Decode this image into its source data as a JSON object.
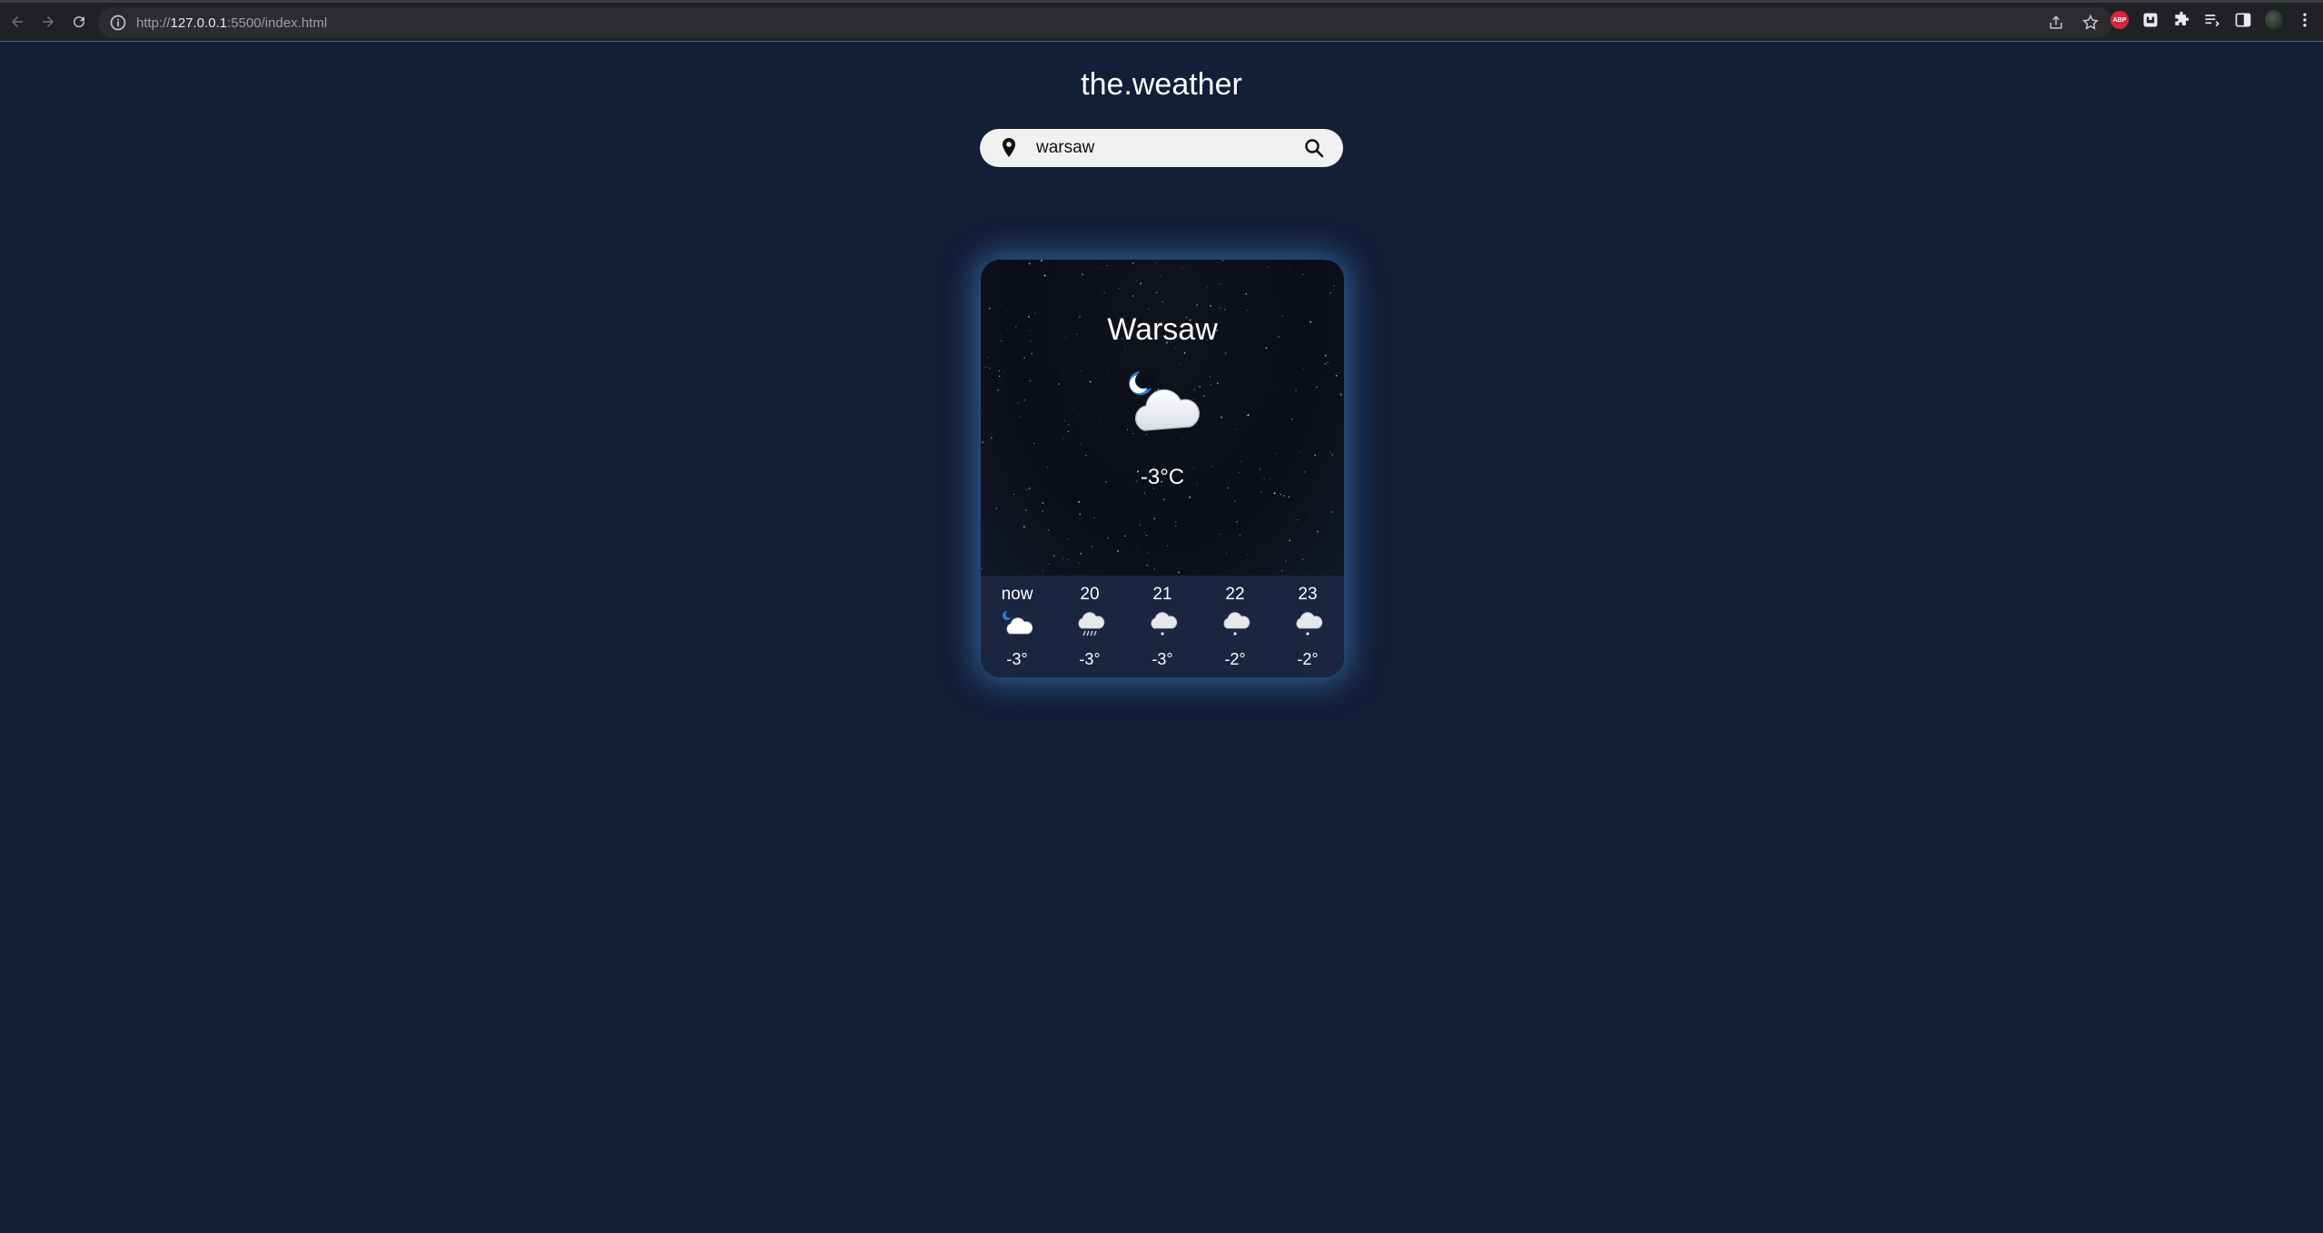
{
  "browser": {
    "url_scheme": "http://",
    "url_host": "127.0.0.1",
    "url_rest": ":5500/index.html",
    "extensions": [
      "abp-icon",
      "ublock-icon",
      "puzzle-icon",
      "reading-list-icon",
      "side-panel-icon"
    ]
  },
  "app": {
    "title": "the.weather"
  },
  "search": {
    "value": "warsaw",
    "placeholder": ""
  },
  "current": {
    "city": "Warsaw",
    "temperature": "-3°C",
    "icon": "moon-cloud-icon"
  },
  "forecast": [
    {
      "label": "now",
      "icon": "moon-cloud-icon",
      "temp": "-3°"
    },
    {
      "label": "20",
      "icon": "cloud-rain-icon",
      "temp": "-3°"
    },
    {
      "label": "21",
      "icon": "cloud-snow-icon",
      "temp": "-3°"
    },
    {
      "label": "22",
      "icon": "cloud-snow-icon",
      "temp": "-2°"
    },
    {
      "label": "23",
      "icon": "cloud-snow-icon",
      "temp": "-2°"
    }
  ],
  "colors": {
    "page_bg": "#131e37",
    "card_glow": "#4696e6",
    "forecast_bg": "#1a2540"
  }
}
